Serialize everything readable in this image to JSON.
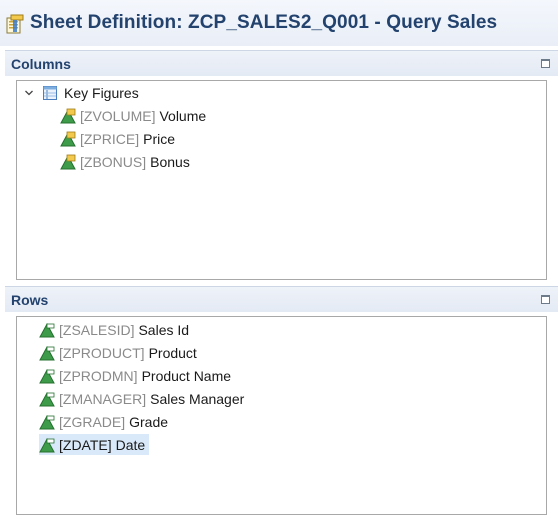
{
  "title": {
    "text": "Sheet Definition: ZCP_SALES2_Q001 - Query Sales",
    "icon": "sheet-definition-icon"
  },
  "columns": {
    "label": "Columns",
    "folder": {
      "label": "Key Figures",
      "icon": "key-figures-icon",
      "expanded": true
    },
    "items": [
      {
        "tech": "[ZVOLUME]",
        "desc": "Volume",
        "icon": "key-figure-icon"
      },
      {
        "tech": "[ZPRICE]",
        "desc": "Price",
        "icon": "key-figure-icon"
      },
      {
        "tech": "[ZBONUS]",
        "desc": "Bonus",
        "icon": "key-figure-icon"
      }
    ]
  },
  "rows": {
    "label": "Rows",
    "items": [
      {
        "tech": "[ZSALESID]",
        "desc": "Sales Id",
        "icon": "characteristic-icon"
      },
      {
        "tech": "[ZPRODUCT]",
        "desc": "Product",
        "icon": "characteristic-icon"
      },
      {
        "tech": "[ZPRODMN]",
        "desc": "Product Name",
        "icon": "characteristic-icon"
      },
      {
        "tech": "[ZMANAGER]",
        "desc": "Sales Manager",
        "icon": "characteristic-icon"
      },
      {
        "tech": "[ZGRADE]",
        "desc": "Grade",
        "icon": "characteristic-icon"
      },
      {
        "tech": "[ZDATE]",
        "desc": "Date",
        "icon": "characteristic-icon",
        "selected": true
      }
    ]
  },
  "colors": {
    "title_text": "#23436e",
    "selection": "#dae9f9",
    "technical_name": "#8a8a8a"
  }
}
